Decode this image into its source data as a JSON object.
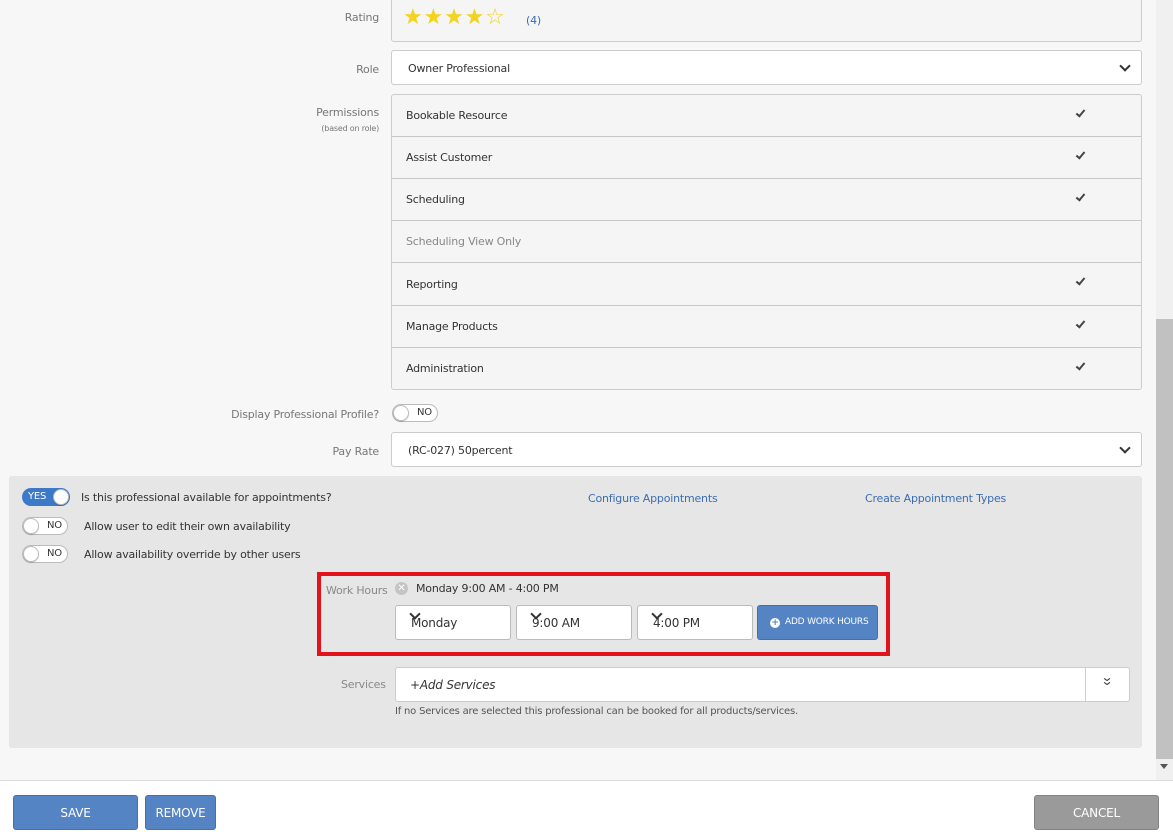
{
  "rating": {
    "label": "Rating",
    "count": "(4)",
    "value": 4,
    "max": 5
  },
  "role": {
    "label": "Role",
    "value": "Owner Professional"
  },
  "permissions": {
    "label": "Permissions",
    "sublabel": "(based on role)",
    "items": [
      {
        "label": "Bookable Resource",
        "checked": true
      },
      {
        "label": "Assist Customer",
        "checked": true
      },
      {
        "label": "Scheduling",
        "checked": true
      },
      {
        "label": "Scheduling View Only",
        "checked": false
      },
      {
        "label": "Reporting",
        "checked": true
      },
      {
        "label": "Manage Products",
        "checked": true
      },
      {
        "label": "Administration",
        "checked": true
      }
    ]
  },
  "display_profile": {
    "label": "Display Professional Profile?",
    "toggle": "NO"
  },
  "pay_rate": {
    "label": "Pay Rate",
    "value": "(RC-027) 50percent"
  },
  "availability": {
    "available": {
      "toggle": "YES",
      "label": "Is this professional available for appointments?"
    },
    "edit_own": {
      "toggle": "NO",
      "label": "Allow user to edit their own availability"
    },
    "override": {
      "toggle": "NO",
      "label": "Allow availability override by other users"
    },
    "configure_link": "Configure Appointments",
    "create_types_link": "Create Appointment Types"
  },
  "work_hours": {
    "label": "Work Hours",
    "entry": "Monday 9:00 AM - 4:00 PM",
    "day": "Monday",
    "start": "9:00 AM",
    "end": "4:00 PM",
    "add_button": "ADD WORK HOURS"
  },
  "services": {
    "label": "Services",
    "placeholder": "+Add Services",
    "help": "If no Services are selected this professional can be booked for all products/services."
  },
  "footer": {
    "save": "SAVE",
    "remove": "REMOVE",
    "cancel": "CANCEL"
  },
  "colors": {
    "primary": "#5584c4",
    "highlight": "#e0141a",
    "cancel": "#9a9a9a",
    "star": "#f4d31c"
  }
}
